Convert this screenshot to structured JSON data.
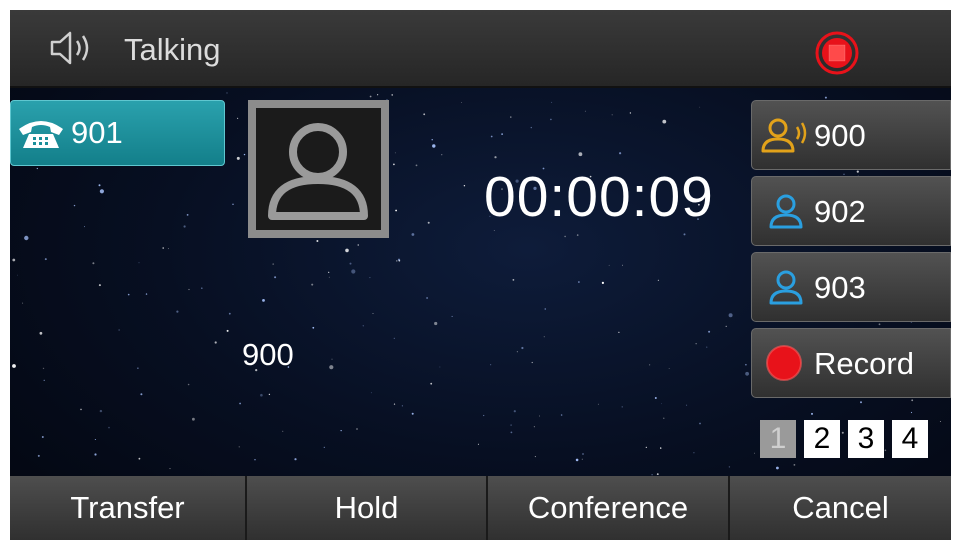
{
  "title_bar": {
    "status": "Talking",
    "speaker_icon": "speaker-icon",
    "record_icon": "record-stop-icon",
    "record_color": "#e8121a"
  },
  "line_key": {
    "label": "901",
    "icon": "phone-icon",
    "color": "#1a8f9a"
  },
  "call": {
    "timer": "00:00:09",
    "remote_number": "900",
    "avatar_icon": "contact-avatar-icon"
  },
  "side_keys": [
    {
      "label": "900",
      "icon": "talking-contact-icon",
      "color": "#e2a21a"
    },
    {
      "label": "902",
      "icon": "contact-icon",
      "color": "#2a9fe0"
    },
    {
      "label": "903",
      "icon": "contact-icon",
      "color": "#2a9fe0"
    },
    {
      "label": "Record",
      "icon": "record-dot-icon",
      "color": "#e8121a"
    }
  ],
  "pages": {
    "items": [
      "1",
      "2",
      "3",
      "4"
    ],
    "active": "1"
  },
  "softkeys": [
    "Transfer",
    "Hold",
    "Conference",
    "Cancel"
  ]
}
